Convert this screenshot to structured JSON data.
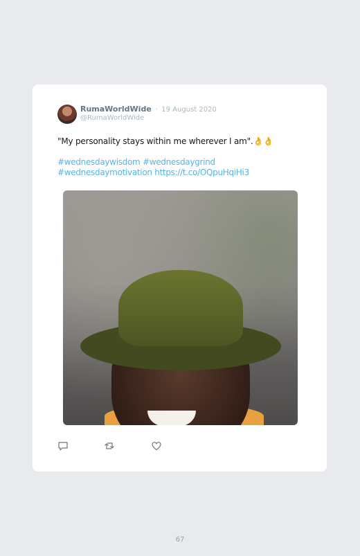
{
  "tweet": {
    "display_name": "RumaWorldWide",
    "separator": "·",
    "date": "19 August 2020",
    "handle": "@RumaWorldWide",
    "text": "\"My personality stays within me wherever I am\".",
    "emoji": "👌👌",
    "hashtags": [
      "#wednesdaywisdom",
      "#wednesdaygrind",
      "#wednesdaymotivation"
    ],
    "link": "https://t.co/OQpuHqiHi3"
  },
  "actions": [
    "reply-icon",
    "retweet-icon",
    "like-icon"
  ],
  "colors": {
    "link": "#55b4e6",
    "name": "#66757f",
    "muted": "#aab8c2",
    "background": "#e8eaed"
  },
  "page": {
    "number": "67"
  }
}
